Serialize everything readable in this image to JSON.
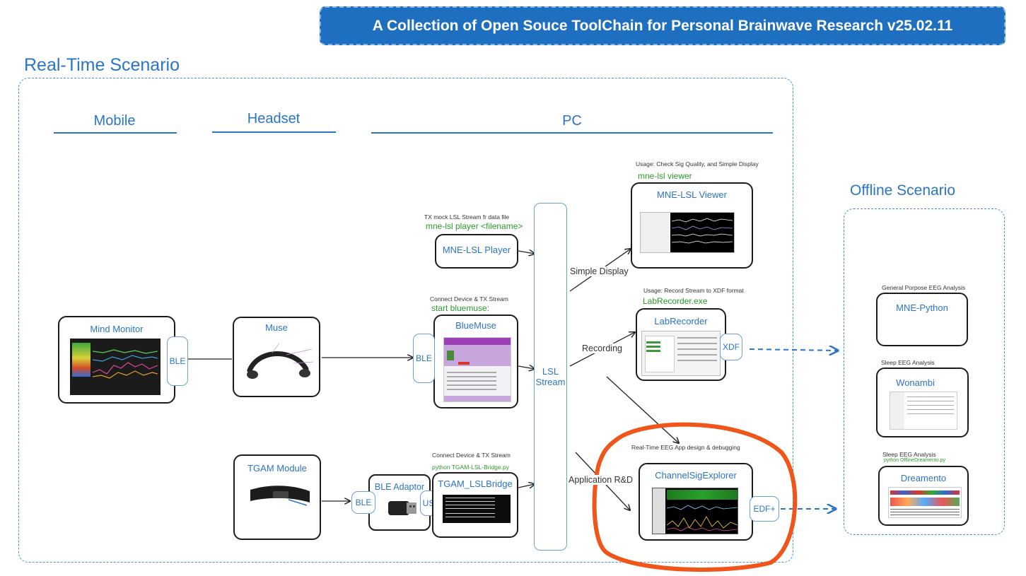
{
  "banner": "A Collection of Open Souce ToolChain for Personal Brainwave Research  v25.02.11",
  "realtime": {
    "title": "Real-Time Scenario",
    "columns": {
      "mobile": "Mobile",
      "headset": "Headset",
      "pc": "PC"
    }
  },
  "offline": {
    "title": "Offline Scenario"
  },
  "nodes": {
    "mind_monitor": {
      "title": "Mind Monitor",
      "ble": "BLE"
    },
    "muse": {
      "title": "Muse"
    },
    "tgam": {
      "title": "TGAM Module"
    },
    "ble_adaptor": {
      "title": "BLE Adaptor",
      "ble": "BLE",
      "usb": "USB"
    },
    "mne_player": {
      "title": "MNE-LSL Player",
      "note": "TX mock LSL Stream fr data file",
      "cmd": "mne-lsl player <filename>"
    },
    "bluemuse": {
      "title": "BlueMuse",
      "ble": "BLE",
      "note": "Connect Device & TX Stream",
      "cmd": "start bluemuse:"
    },
    "tgam_bridge": {
      "title": "TGAM_LSLBridge",
      "note": "Connect Device & TX Stream",
      "cmd": "python TGAM-LSL-Bridge.py"
    },
    "lsl_stream": {
      "line1": "LSL",
      "line2": "Stream"
    },
    "mne_viewer": {
      "title": "MNE-LSL Viewer",
      "note": "Usage: Check Sig Quality, and Simple Display",
      "cmd": "mne-lsl viewer"
    },
    "labrecorder": {
      "title": "LabRecorder",
      "note": "Usage: Record Stream to XDF format",
      "cmd": "LabRecorder.exe",
      "out": "XDF"
    },
    "channel_sig": {
      "title": "ChannelSigExplorer",
      "note": "Real-Time EEG App design & debugging",
      "out": "EDF+"
    },
    "mne_python": {
      "title": "MNE-Python",
      "note": "General Porpose EEG Analysis"
    },
    "wonambi": {
      "title": "Wonambi",
      "note": "Sleep EEG Analysis"
    },
    "dreamento": {
      "title": "Dreamento",
      "note": "Sleep EEG Analysis",
      "cmd": "python OfflineDreamento.py"
    }
  },
  "edges": {
    "simple_display": "Simple Display",
    "recording": "Recording",
    "app_rd": "Application R&D"
  },
  "colors": {
    "accent": "#2a75c8",
    "banner": "#1f6fc1",
    "highlight": "#f0561a",
    "cmd": "#2a9c2a"
  }
}
